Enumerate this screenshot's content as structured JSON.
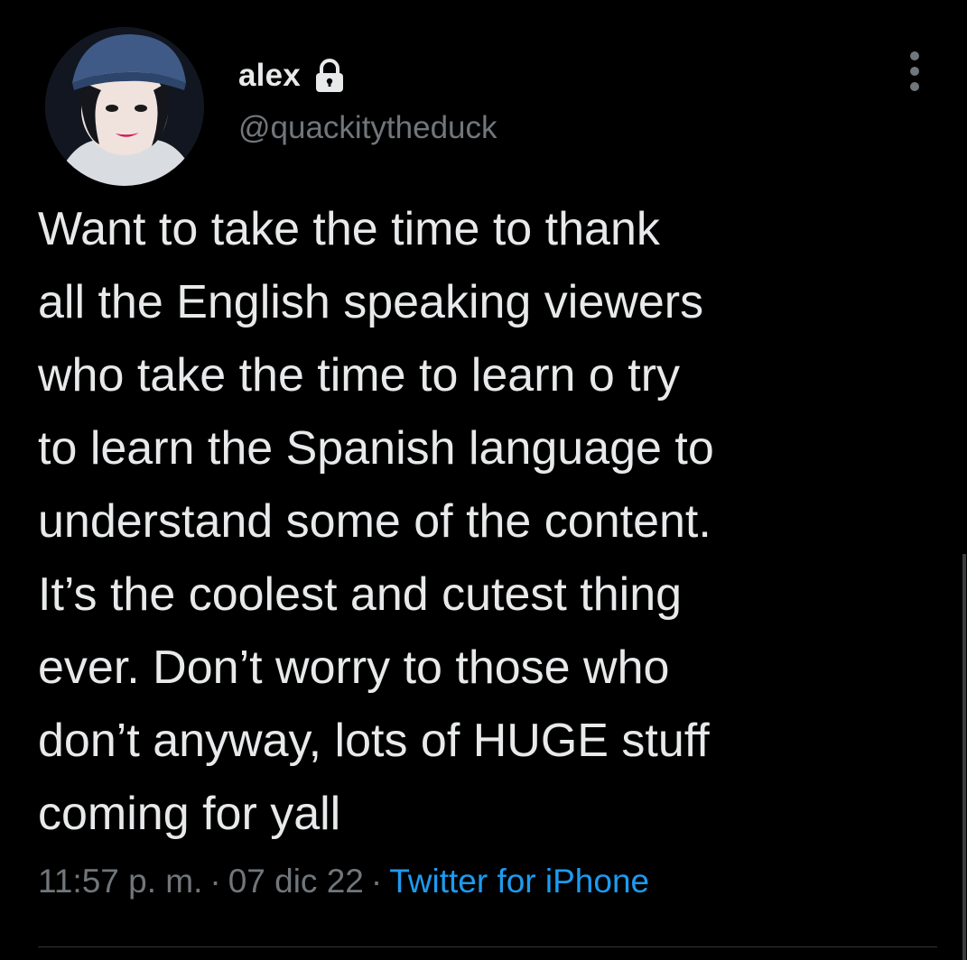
{
  "tweet": {
    "author": {
      "display_name": "alex",
      "handle": "@quackitytheduck",
      "avatar_icon": "avatar-photo",
      "protected_icon": "lock-icon"
    },
    "text_lines": [
      "Want to take the time to thank",
      "all the English speaking viewers",
      "who take the time to learn o try",
      "to learn the Spanish language to",
      "understand some of the content.",
      "It’s the coolest and cutest thing",
      "ever. Don’t worry to those who",
      "don’t anyway, lots of HUGE stuff",
      "coming for yall"
    ],
    "time": "11:57 p. m.",
    "separator": "·",
    "date": "07 dic 22",
    "source": "Twitter for iPhone"
  },
  "colors": {
    "background": "#000000",
    "primary_text": "#e7e9ea",
    "secondary_text": "#71767b",
    "link": "#1d9bf0",
    "divider": "#2f3336"
  }
}
